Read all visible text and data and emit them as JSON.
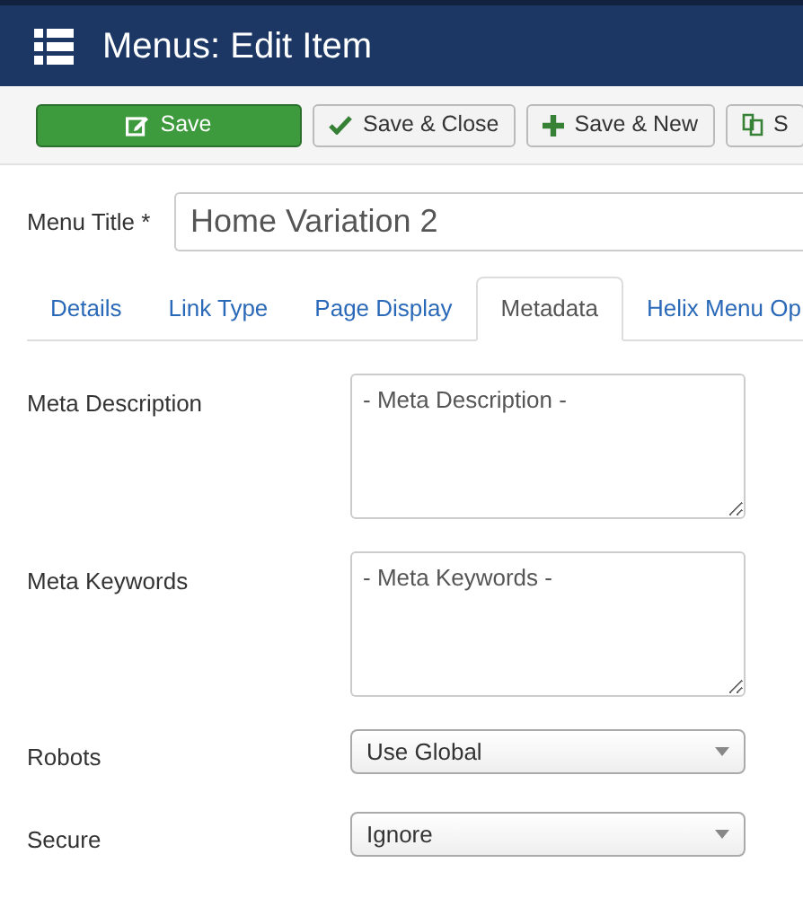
{
  "header": {
    "title": "Menus: Edit Item"
  },
  "toolbar": [
    {
      "label": "Save",
      "kind": "save"
    },
    {
      "label": "Save & Close",
      "kind": "close"
    },
    {
      "label": "Save & New",
      "kind": "new"
    },
    {
      "label": "S",
      "kind": "copy"
    }
  ],
  "menu_title": {
    "label": "Menu Title *",
    "value": "Home Variation 2"
  },
  "tabs": [
    {
      "label": "Details",
      "selected": false
    },
    {
      "label": "Link Type",
      "selected": false
    },
    {
      "label": "Page Display",
      "selected": false
    },
    {
      "label": "Metadata",
      "selected": true
    },
    {
      "label": "Helix Menu Op",
      "selected": false
    }
  ],
  "fields": [
    {
      "label": "Meta Description",
      "kind": "textarea",
      "placeholder": "- Meta Description -"
    },
    {
      "label": "Meta Keywords",
      "kind": "textarea",
      "placeholder": "- Meta Keywords -"
    },
    {
      "label": "Robots",
      "kind": "select",
      "value": "Use Global"
    },
    {
      "label": "Secure",
      "kind": "select",
      "value": "Ignore"
    }
  ]
}
